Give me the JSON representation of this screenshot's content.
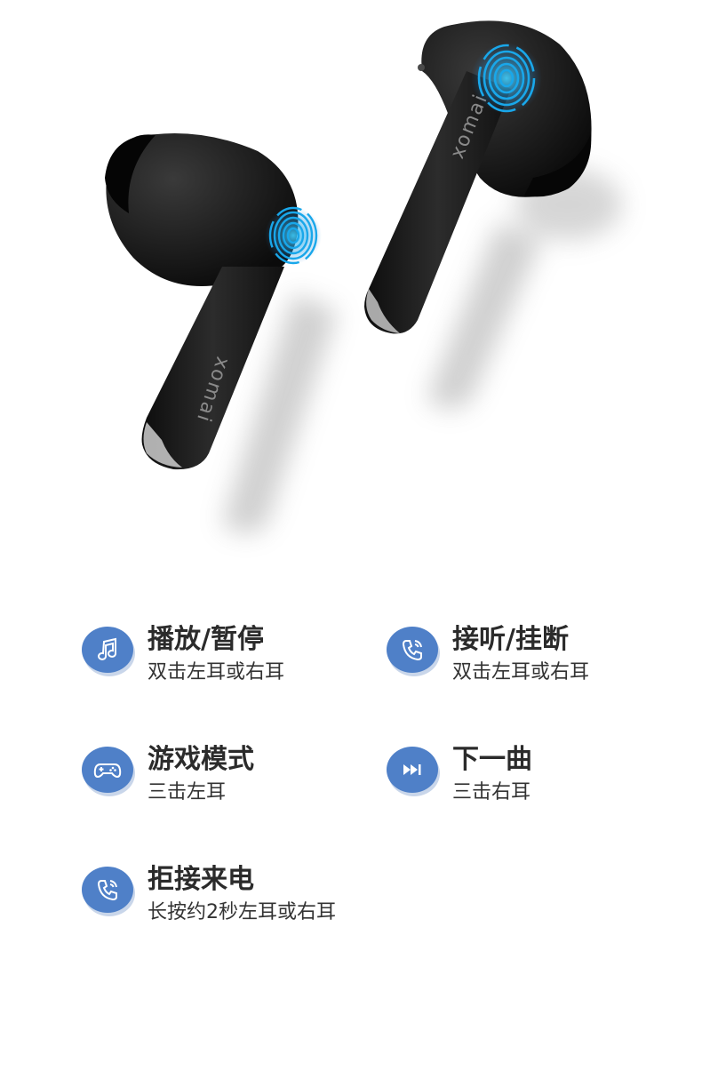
{
  "product": {
    "brand_mark": "xomai"
  },
  "features": [
    {
      "icon": "music-note-icon",
      "title": "播放/暂停",
      "desc": "双击左耳或右耳"
    },
    {
      "icon": "phone-call-icon",
      "title": "接听/挂断",
      "desc": "双击左耳或右耳"
    },
    {
      "icon": "gamepad-icon",
      "title": "游戏模式",
      "desc": "三击左耳"
    },
    {
      "icon": "next-track-icon",
      "title": "下一曲",
      "desc": "三击右耳"
    },
    {
      "icon": "phone-call-icon",
      "title": "拒接来电",
      "desc": "长按约2秒左耳或右耳"
    }
  ],
  "colors": {
    "accent": "#4f80c8",
    "fingerprint": "#19a7ea",
    "earbud": "#1c1c1c"
  }
}
